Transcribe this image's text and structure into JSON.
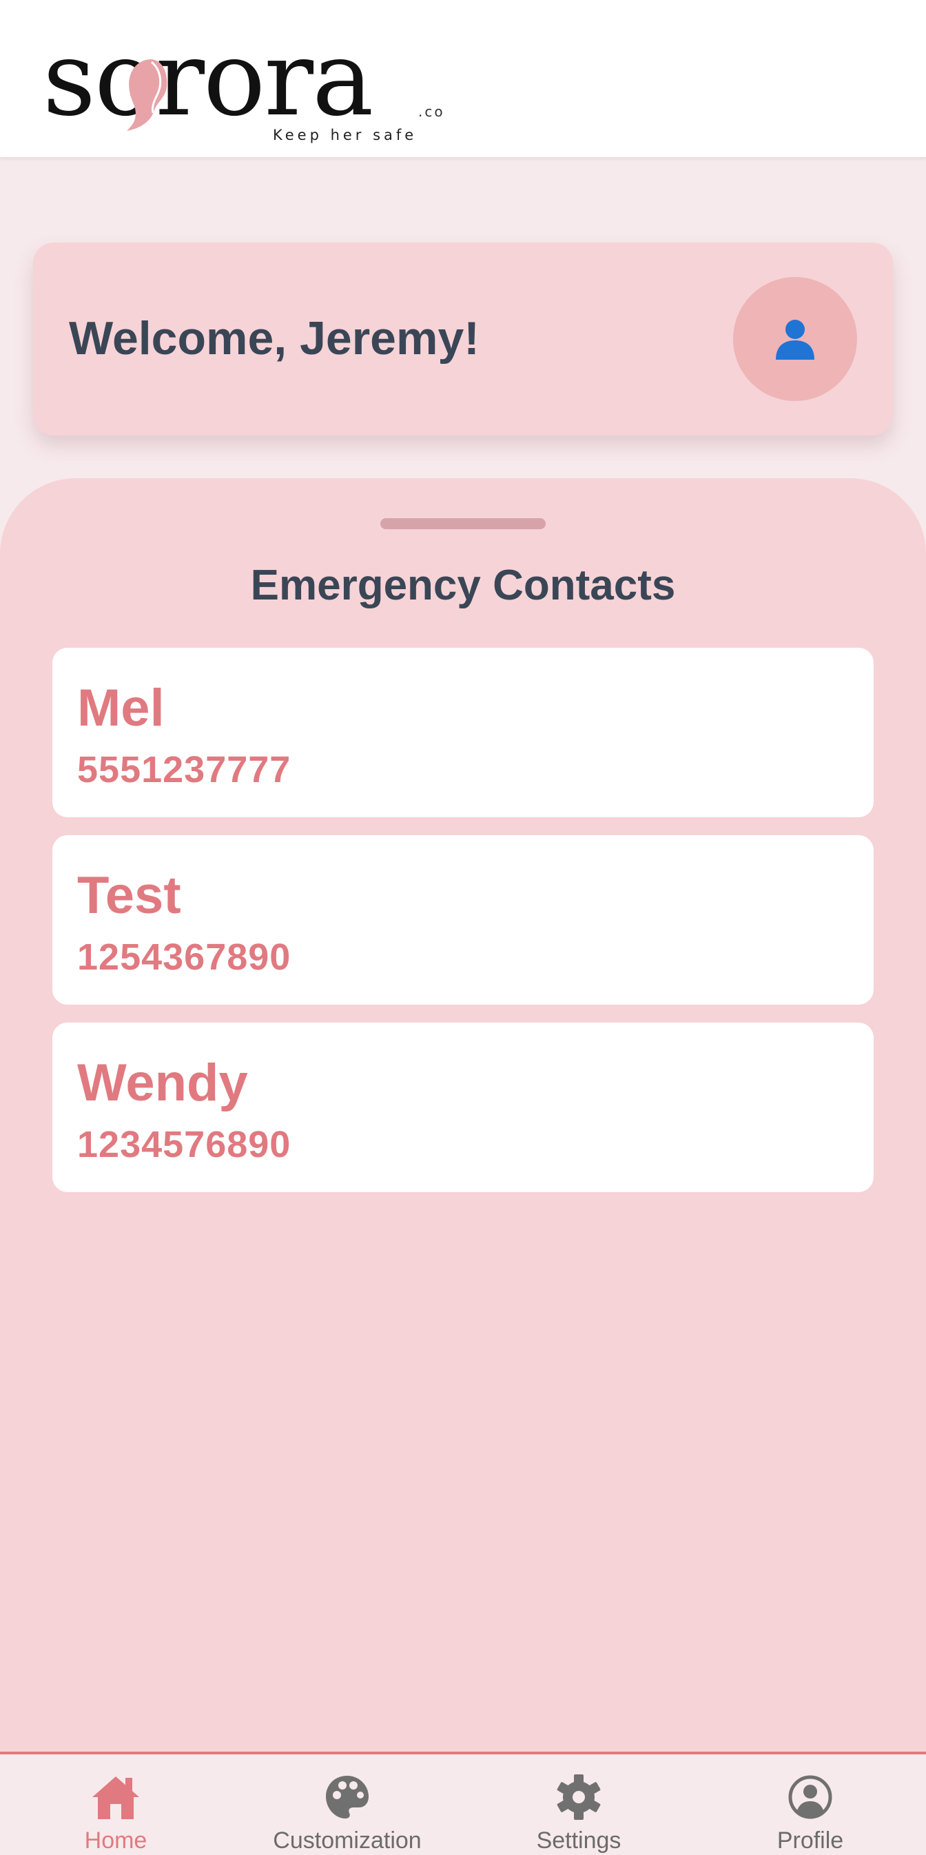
{
  "brand": {
    "name": "sorora",
    "suffix": ".co",
    "tagline": "Keep her safe"
  },
  "welcome": {
    "text": "Welcome, Jeremy!",
    "avatar_icon": "user-icon"
  },
  "contacts_sheet": {
    "title": "Emergency Contacts",
    "contacts": [
      {
        "name": "Mel",
        "phone": "5551237777"
      },
      {
        "name": "Test",
        "phone": "1254367890"
      },
      {
        "name": "Wendy",
        "phone": "1234576890"
      }
    ]
  },
  "bottom_nav": {
    "active": "Home",
    "items": [
      {
        "label": "Home",
        "icon": "home-icon"
      },
      {
        "label": "Customization",
        "icon": "palette-icon"
      },
      {
        "label": "Settings",
        "icon": "gear-icon"
      },
      {
        "label": "Profile",
        "icon": "profile-icon"
      }
    ]
  },
  "colors": {
    "accent": "#e07a80",
    "card_pink": "#f6d3d7",
    "text_dark": "#3a4656",
    "nav_inactive": "#6b6b6b"
  }
}
